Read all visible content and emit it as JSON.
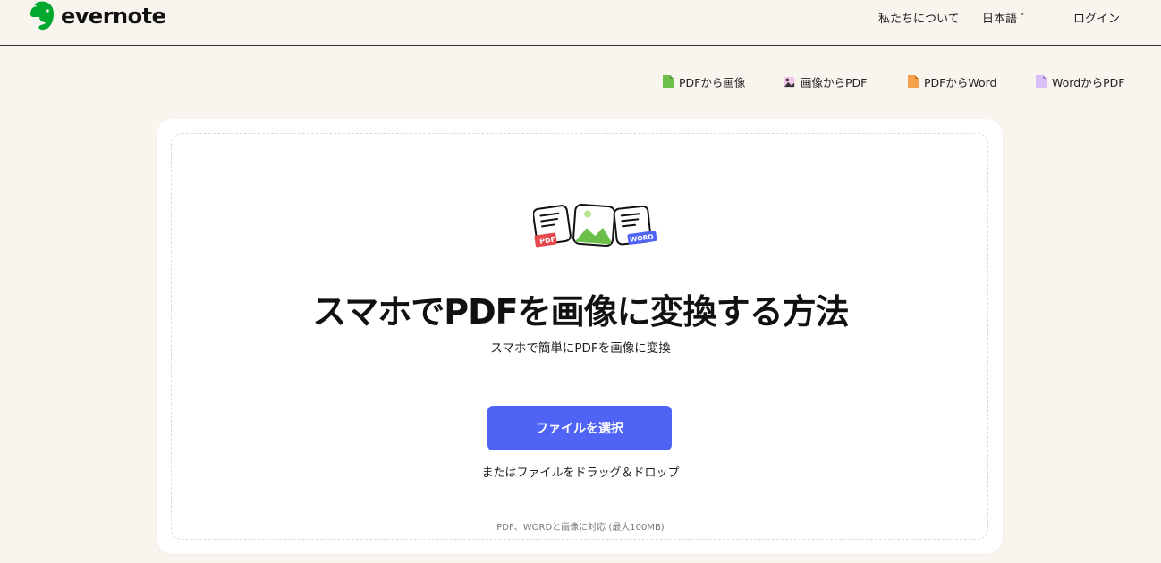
{
  "header": {
    "logo_text": "evernote",
    "nav": {
      "about": "私たちについて",
      "language": "日本語",
      "login": "ログイン"
    }
  },
  "tools": [
    {
      "label": "PDFから画像",
      "icon": "pdf-file-icon",
      "color": "#6cc04a"
    },
    {
      "label": "画像からPDF",
      "icon": "image-file-icon",
      "color": "#e59ad6"
    },
    {
      "label": "PDFからWord",
      "icon": "pdf-word-file-icon",
      "color": "#f5a04b"
    },
    {
      "label": "WordからPDF",
      "icon": "word-file-icon",
      "color": "#c9a6f2"
    }
  ],
  "main": {
    "illustration_badges": {
      "pdf": "PDF",
      "word": "WORD"
    },
    "title": "スマホでPDFを画像に変換する方法",
    "subtitle": "スマホで簡単にPDFを画像に変換",
    "select_button": "ファイルを選択",
    "drag_text": "またはファイルをドラッグ＆ドロップ",
    "support_text": "PDF、WORDと画像に対応 (最大100MB)"
  },
  "colors": {
    "background": "#f8f4ee",
    "accent": "#4f64f5",
    "brand_green": "#00a82d"
  }
}
